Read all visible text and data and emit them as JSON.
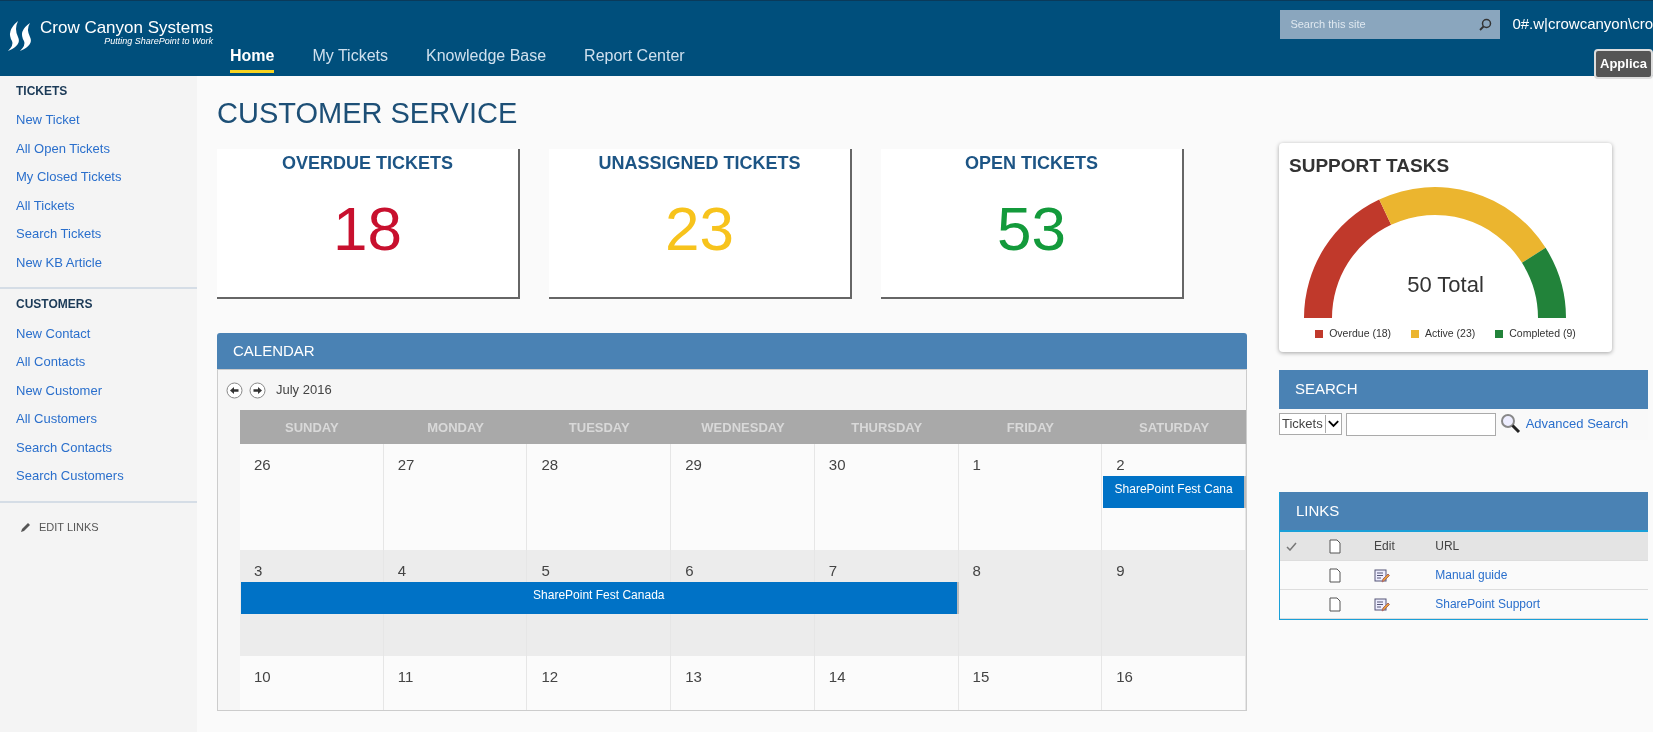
{
  "header": {
    "logo_title": "Crow Canyon Systems",
    "logo_tagline": "Putting SharePoint to Work",
    "nav": [
      {
        "label": "Home",
        "selected": true
      },
      {
        "label": "My Tickets",
        "selected": false
      },
      {
        "label": "Knowledge Base",
        "selected": false
      },
      {
        "label": "Report Center",
        "selected": false
      }
    ],
    "search": {
      "placeholder": "Search this site"
    },
    "user": "0#.w|crowcanyon\\cro",
    "app_button": "Applica"
  },
  "sidebar": {
    "sections": [
      {
        "heading": "TICKETS",
        "items": [
          "New Ticket",
          "All Open Tickets",
          "My Closed Tickets",
          "All Tickets",
          "Search Tickets",
          "New KB Article"
        ]
      },
      {
        "heading": "CUSTOMERS",
        "items": [
          "New Contact",
          "All Contacts",
          "New Customer",
          "All Customers",
          "Search Contacts",
          "Search Customers"
        ]
      }
    ],
    "edit_links": "EDIT LINKS"
  },
  "page_title": "CUSTOMER SERVICE",
  "stat_cards": [
    {
      "title": "OVERDUE TICKETS",
      "value": "18",
      "color": "#c8102e"
    },
    {
      "title": "UNASSIGNED TICKETS",
      "value": "23",
      "color": "#f7c31c"
    },
    {
      "title": "OPEN TICKETS",
      "value": "53",
      "color": "#139a3b"
    }
  ],
  "calendar": {
    "title": "CALENDAR",
    "month": "July 2016",
    "weekdays": [
      "SUNDAY",
      "MONDAY",
      "TUESDAY",
      "WEDNESDAY",
      "THURSDAY",
      "FRIDAY",
      "SATURDAY"
    ],
    "weeks": [
      {
        "current": false,
        "days": [
          {
            "date": "26"
          },
          {
            "date": "27"
          },
          {
            "date": "28"
          },
          {
            "date": "29"
          },
          {
            "date": "30"
          },
          {
            "date": "1"
          },
          {
            "date": "2",
            "event": "SharePoint Fest Cana"
          }
        ]
      },
      {
        "current": true,
        "days": [
          {
            "date": "3",
            "event": "SharePoint Fest Canada"
          },
          {
            "date": "4",
            "event_continues": true
          },
          {
            "date": "5",
            "event_continues": true
          },
          {
            "date": "6",
            "event_continues": true
          },
          {
            "date": "7",
            "event_continues": true
          },
          {
            "date": "8"
          },
          {
            "date": "9"
          }
        ]
      },
      {
        "current": false,
        "days": [
          {
            "date": "10"
          },
          {
            "date": "11"
          },
          {
            "date": "12"
          },
          {
            "date": "13"
          },
          {
            "date": "14"
          },
          {
            "date": "15"
          },
          {
            "date": "16"
          }
        ]
      }
    ]
  },
  "support_tasks": {
    "title": "SUPPORT TASKS",
    "total_label": "50 Total",
    "chart_data": {
      "type": "donut",
      "categories": [
        "Overdue (18)",
        "Active (23)",
        "Completed (9)"
      ],
      "values": [
        18,
        23,
        9
      ],
      "colors": [
        "#c0392b",
        "#ebb52f",
        "#22833a"
      ]
    }
  },
  "search_panel": {
    "title": "SEARCH",
    "scope": "Tickets",
    "advanced_link": "Advanced Search"
  },
  "links_panel": {
    "title": "LINKS",
    "columns": [
      "Edit",
      "URL"
    ],
    "rows": [
      "Manual guide",
      "SharePoint Support"
    ]
  }
}
